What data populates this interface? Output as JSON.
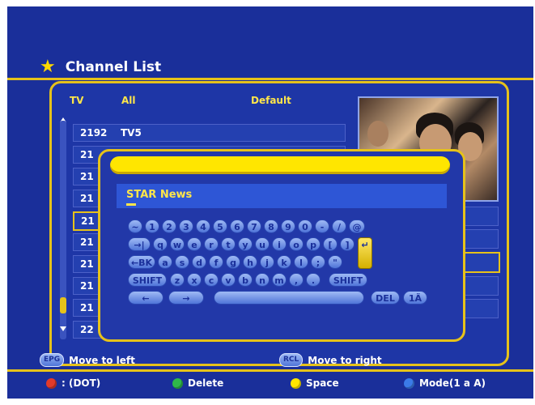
{
  "header": {
    "title": "Channel List"
  },
  "list": {
    "headers": [
      "TV",
      "All",
      "Default"
    ],
    "rows": [
      {
        "num": "2192",
        "name": "TV5"
      },
      {
        "num": "21",
        "name": ""
      },
      {
        "num": "21",
        "name": ""
      },
      {
        "num": "21",
        "name": ""
      },
      {
        "num": "21",
        "name": ""
      },
      {
        "num": "21",
        "name": ""
      },
      {
        "num": "21",
        "name": ""
      },
      {
        "num": "21",
        "name": ""
      },
      {
        "num": "21",
        "name": ""
      },
      {
        "num": "22",
        "name": ""
      }
    ]
  },
  "keyboard": {
    "input_value": "STAR News",
    "row1": [
      "~",
      "1",
      "2",
      "3",
      "4",
      "5",
      "6",
      "7",
      "8",
      "9",
      "0",
      "-",
      "/",
      "@"
    ],
    "row2": [
      "→|",
      "q",
      "w",
      "e",
      "r",
      "t",
      "y",
      "u",
      "i",
      "o",
      "p",
      "[",
      "]"
    ],
    "row3": [
      "←BK",
      "a",
      "s",
      "d",
      "f",
      "g",
      "h",
      "j",
      "k",
      "l",
      ";",
      "\""
    ],
    "row4": [
      "SHIFT",
      "z",
      "x",
      "c",
      "v",
      "b",
      "n",
      "m",
      ",",
      ".",
      "SHIFT"
    ],
    "row5": {
      "left": "←",
      "right": "→",
      "del": "DEL",
      "mode": "1Ä"
    }
  },
  "hints": {
    "epg_key": "EPG",
    "epg_label": "Move to left",
    "rcl_key": "RCL",
    "rcl_label": "Move to right",
    "red_label": ": (DOT)",
    "green_label": "Delete",
    "yellow_label": "Space",
    "blue_label": "Mode(1 a A)"
  },
  "colors": {
    "background": "#1a2f9a",
    "accent": "#e6c21a",
    "red": "#e23a2a",
    "green": "#2fb84a",
    "yellow": "#ffe600",
    "blue": "#3b7be8"
  }
}
